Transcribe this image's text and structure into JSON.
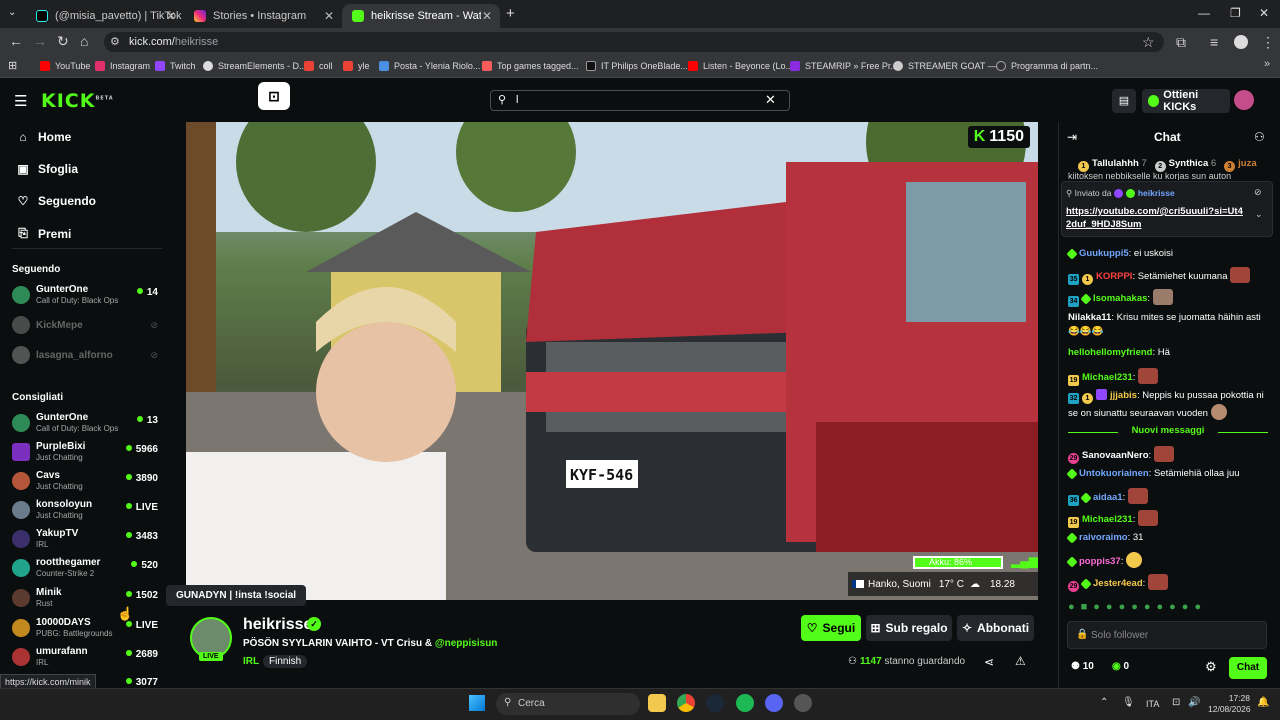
{
  "browser": {
    "tabs": [
      {
        "label": "(@misia_pavetto) | TikTok"
      },
      {
        "label": "Stories • Instagram"
      },
      {
        "label": "heikrisse Stream - Watch Li"
      }
    ],
    "url_host": "kick.com/",
    "url_path": "heikrisse",
    "bookmarks": [
      "YouTube",
      "Instagram",
      "Twitch",
      "StreamElements - D...",
      "coll",
      "yle",
      "Posta - Ylenia Riolo...",
      "Top games tagged...",
      "IT Philips OneBlade...",
      "Listen - Beyonce (Lo...",
      "STEAMRIP » Free Pr...",
      "STREAMER GOAT —...",
      "Programma di partn..."
    ],
    "status_url": "https://kick.com/minik"
  },
  "header": {
    "logo": "KICK",
    "logo_beta": "BETA",
    "search_value": "l",
    "kicks_label": "Ottieni KICKs"
  },
  "sidebar": {
    "nav": [
      {
        "label": "Home",
        "icon": "home-icon"
      },
      {
        "label": "Sfoglia",
        "icon": "browse-icon"
      },
      {
        "label": "Seguendo",
        "icon": "heart-icon"
      },
      {
        "label": "Premi",
        "icon": "gift-icon"
      }
    ],
    "following_title": "Seguendo",
    "following": [
      {
        "name": "GunterOne",
        "sub": "Call of Duty: Black Ops",
        "viewers": "14",
        "online": true
      },
      {
        "name": "KickMepe",
        "sub": "",
        "viewers": "",
        "online": false
      },
      {
        "name": "lasagna_alforno",
        "sub": "",
        "viewers": "",
        "online": false
      }
    ],
    "recommended_title": "Consigliati",
    "recommended": [
      {
        "name": "GunterOne",
        "sub": "Call of Duty: Black Ops",
        "viewers": "13"
      },
      {
        "name": "PurpleBixi",
        "sub": "Just Chatting",
        "viewers": "5966"
      },
      {
        "name": "Cavs",
        "sub": "Just Chatting",
        "viewers": "3890"
      },
      {
        "name": "konsoloyun",
        "sub": "Just Chatting",
        "viewers": "LIVE"
      },
      {
        "name": "YakupTV",
        "sub": "IRL",
        "viewers": "3483"
      },
      {
        "name": "rootthegamer",
        "sub": "Counter-Strike 2",
        "viewers": "520"
      },
      {
        "name": "Minik",
        "sub": "Rust",
        "viewers": "1502"
      },
      {
        "name": "10000DAYS",
        "sub": "PUBG: Battlegrounds",
        "viewers": "LIVE"
      },
      {
        "name": "umurafann",
        "sub": "IRL",
        "viewers": "2689"
      },
      {
        "name": "",
        "sub": "",
        "viewers": "3077"
      }
    ],
    "tooltip": "GUNADYN | !insta !social"
  },
  "video": {
    "kick_count": "1150",
    "battery": "Akku: 86%",
    "location": "Hanko, Suomi",
    "temp": "17° C",
    "time": "18.28",
    "plate": "KYF-546"
  },
  "stream": {
    "name": "heikrisse",
    "live": "LIVE",
    "title": "PÖSÖN SYYLARIN VAIHTO - VT Crisu & ",
    "title_mention": "@neppisisun",
    "category": "IRL",
    "language": "Finnish",
    "follow_label": "Segui",
    "gift_label": "Sub regalo",
    "sub_label": "Abbonati",
    "viewers": "1147",
    "viewers_suffix": "stanno guardando"
  },
  "chat": {
    "title": "Chat",
    "top_gifters": [
      {
        "rank": "1",
        "name": "Tallulahhh",
        "count": "7"
      },
      {
        "rank": "2",
        "name": "Synthica",
        "count": "6"
      },
      {
        "rank": "3",
        "name": "juza",
        "count": ""
      }
    ],
    "top_cut_text": "kiitoksen nebbikselle ku korjas sun auton",
    "pinned_by_label": "Inviato da",
    "pinned_by": "heikrisse",
    "pinned_link": "https://youtube.com/@cri5uuuli?si=Ut42duf_9HDJ8Sum",
    "messages_before": [
      {
        "user": "Guukuppi5",
        "text": "ei uskoisi",
        "color": "#72a7ff"
      },
      {
        "user": "KORPPI",
        "text": "Setämiehet kuumana",
        "color": "#ff4040"
      },
      {
        "user": "Isomahakas",
        "text": "",
        "color": "#53fc18"
      },
      {
        "user": "Nilakka11",
        "text": "Krisu mites se juomatta häihin asti",
        "color": "#ffffff"
      },
      {
        "user": "hellohellomyfriend",
        "text": "Hä",
        "color": "#53fc18"
      },
      {
        "user": "Michael231",
        "text": "",
        "color": "#53fc18"
      },
      {
        "user": "jjjabis",
        "text": "Neppis ku pussaa pokottia ni se on siunattu seuraavan vuoden",
        "color": "#f2c94c"
      }
    ],
    "new_messages_label": "Nuovi messaggi",
    "messages_after": [
      {
        "user": "SanovaanNero",
        "text": "",
        "color": "#ffffff"
      },
      {
        "user": "Untokuoriainen",
        "text": "Setämiehiä ollaa juu",
        "color": "#72a7ff"
      },
      {
        "user": "aidaa1",
        "text": "",
        "color": "#72a7ff"
      },
      {
        "user": "Michael231",
        "text": "",
        "color": "#53fc18"
      },
      {
        "user": "raivoraimo",
        "text": "31",
        "color": "#72a7ff"
      },
      {
        "user": "poppis37",
        "text": "",
        "color": "#ff6bd6"
      },
      {
        "user": "Jester4ead",
        "text": "",
        "color": "#f2c94c"
      }
    ],
    "input_placeholder": "Solo follower",
    "points": "10",
    "kicks": "0",
    "send_label": "Chat"
  },
  "taskbar": {
    "search_label": "Cerca",
    "lang": "ITA",
    "time": "17:28",
    "date": "12/08/2026"
  },
  "colors": {
    "accent": "#53fc18",
    "bg": "#0b0e0f"
  }
}
